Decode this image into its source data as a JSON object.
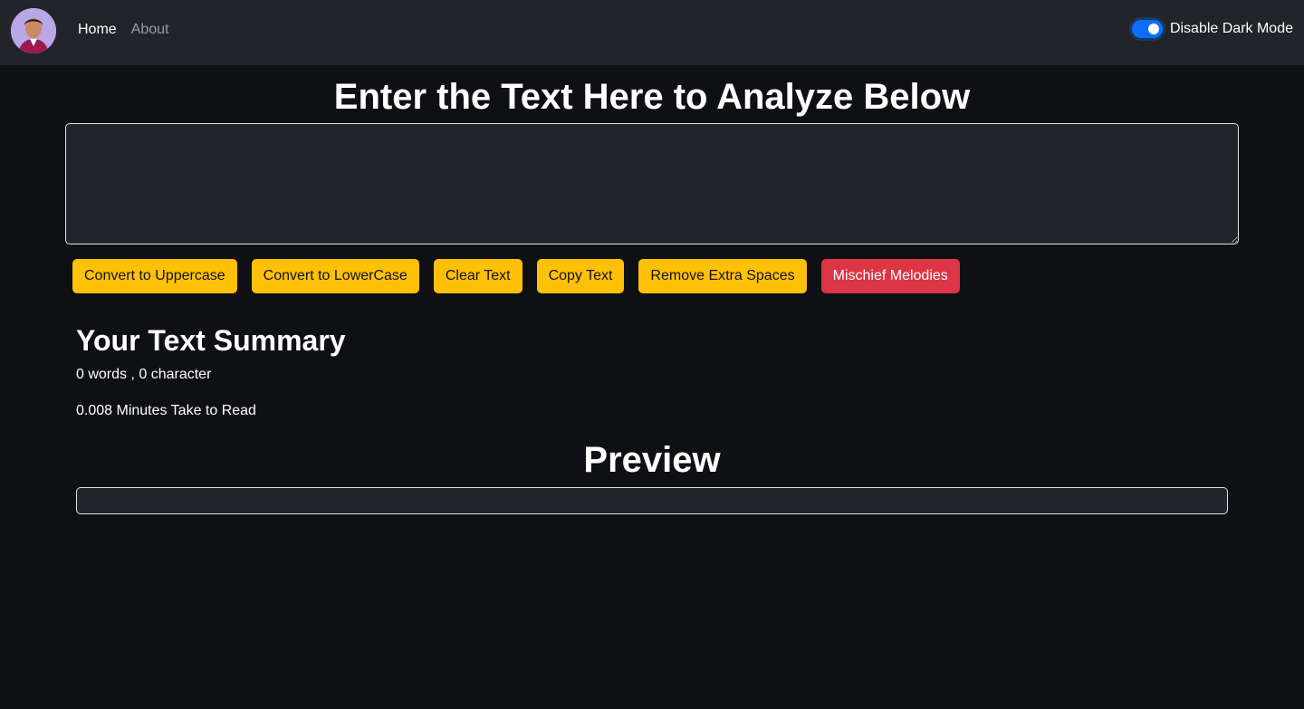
{
  "nav": {
    "links": [
      {
        "label": "Home",
        "active": true
      },
      {
        "label": "About",
        "active": false
      }
    ],
    "toggle_label": "Disable Dark Mode",
    "toggle_on": true
  },
  "main": {
    "title": "Enter the Text Here to Analyze Below",
    "textarea_value": "",
    "buttons": [
      {
        "label": "Convert to Uppercase",
        "color": "#ffc107"
      },
      {
        "label": "Convert to LowerCase",
        "color": "#ffc107"
      },
      {
        "label": "Clear Text",
        "color": "#ffc107"
      },
      {
        "label": "Copy Text",
        "color": "#ffc107"
      },
      {
        "label": "Remove Extra Spaces",
        "color": "#ffc107"
      },
      {
        "label": "Mischief Melodies",
        "color": "#dc3545"
      }
    ]
  },
  "summary": {
    "title": "Your Text Summary",
    "counts": "0 words , 0 character",
    "read_time": "0.008 Minutes Take to Read"
  },
  "preview": {
    "title": "Preview",
    "content": ""
  },
  "colors": {
    "background": "#0e1014",
    "navbar": "#212429",
    "accent_yellow": "#ffc107",
    "accent_red": "#dc3545",
    "toggle_blue": "#0d6efd"
  }
}
